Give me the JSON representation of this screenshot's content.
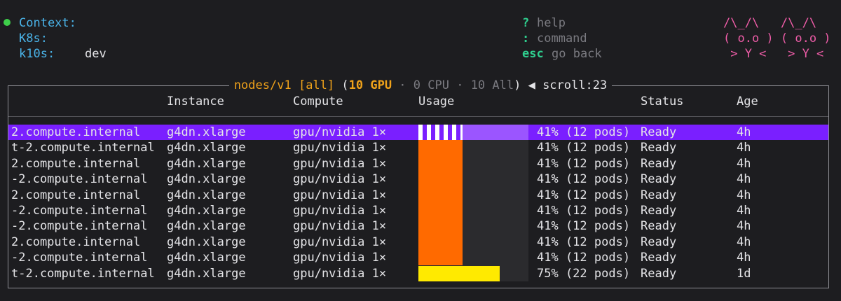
{
  "header": {
    "context_label": "Context:",
    "k8s_label": "K8s:",
    "k10s_label": "k10s:",
    "k10s_value": "dev",
    "hints": [
      {
        "key": "?",
        "desc": "help"
      },
      {
        "key": ":",
        "desc": "command"
      },
      {
        "key": "esc",
        "desc": "go back"
      }
    ],
    "logo": [
      "/\\_/\\   /\\_/\\",
      "( o.o ) ( o.o )",
      " > Y <   > Y <"
    ]
  },
  "view": {
    "resource": "nodes/v1",
    "filter": "[all]",
    "open_paren": "(",
    "gpu_count": "10 GPU",
    "dot1": " · ",
    "cpu_count": "0 CPU",
    "dot2": " · ",
    "all_count": "10 All",
    "close_paren": ")",
    "scroll": " ◀ scroll:23"
  },
  "columns": [
    "",
    "Instance",
    "Compute",
    "Usage",
    "",
    "Status",
    "Age"
  ],
  "rows": [
    {
      "name": "2.compute.internal",
      "instance": "g4dn.xlarge",
      "compute": "gpu/nvidia 1×",
      "usage": "41% (12 pods)",
      "status": "Ready",
      "age": "4h",
      "usage_fraction": 0.41
    },
    {
      "name": "t-2.compute.internal",
      "instance": "g4dn.xlarge",
      "compute": "gpu/nvidia 1×",
      "usage": "41% (12 pods)",
      "status": "Ready",
      "age": "4h",
      "usage_fraction": 0.41
    },
    {
      "name": "2.compute.internal",
      "instance": "g4dn.xlarge",
      "compute": "gpu/nvidia 1×",
      "usage": "41% (12 pods)",
      "status": "Ready",
      "age": "4h",
      "usage_fraction": 0.41
    },
    {
      "name": "-2.compute.internal",
      "instance": "g4dn.xlarge",
      "compute": "gpu/nvidia 1×",
      "usage": "41% (12 pods)",
      "status": "Ready",
      "age": "4h",
      "usage_fraction": 0.41
    },
    {
      "name": "2.compute.internal",
      "instance": "g4dn.xlarge",
      "compute": "gpu/nvidia 1×",
      "usage": "41% (12 pods)",
      "status": "Ready",
      "age": "4h",
      "usage_fraction": 0.41
    },
    {
      "name": "-2.compute.internal",
      "instance": "g4dn.xlarge",
      "compute": "gpu/nvidia 1×",
      "usage": "41% (12 pods)",
      "status": "Ready",
      "age": "4h",
      "usage_fraction": 0.41
    },
    {
      "name": "-2.compute.internal",
      "instance": "g4dn.xlarge",
      "compute": "gpu/nvidia 1×",
      "usage": "41% (12 pods)",
      "status": "Ready",
      "age": "4h",
      "usage_fraction": 0.41
    },
    {
      "name": "2.compute.internal",
      "instance": "g4dn.xlarge",
      "compute": "gpu/nvidia 1×",
      "usage": "41% (12 pods)",
      "status": "Ready",
      "age": "4h",
      "usage_fraction": 0.41
    },
    {
      "name": "-2.compute.internal",
      "instance": "g4dn.xlarge",
      "compute": "gpu/nvidia 1×",
      "usage": "41% (12 pods)",
      "status": "Ready",
      "age": "4h",
      "usage_fraction": 0.41
    },
    {
      "name": "t-2.compute.internal",
      "instance": "g4dn.xlarge",
      "compute": "gpu/nvidia 1×",
      "usage": "75% (22 pods)",
      "status": "Ready",
      "age": "1d",
      "usage_fraction": 0.75
    }
  ],
  "selected_row": 0,
  "colors": {
    "background": "#1d1d20",
    "selection": "#7a1fff",
    "usage_normal": "#ff6a00",
    "usage_high": "#ffea00",
    "accent": "#f0a21a",
    "status_dot": "#3ecf4a",
    "logo": "#ef5da8"
  }
}
